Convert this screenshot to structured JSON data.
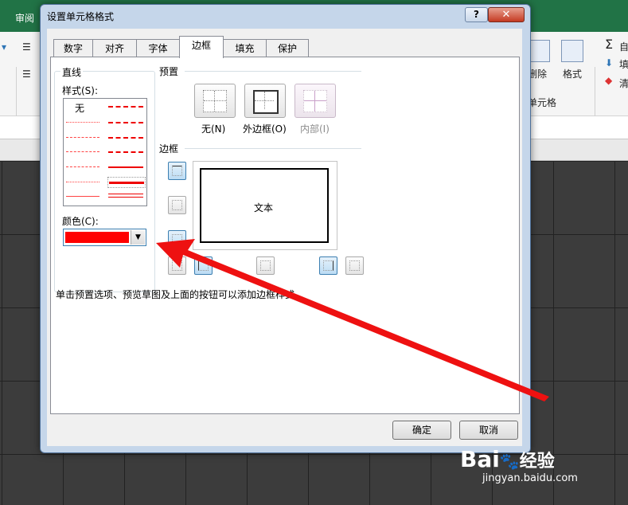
{
  "background": {
    "ribbon_tab": "审阅",
    "ribbon_items": [
      {
        "label": "删除"
      },
      {
        "label": "格式"
      },
      {
        "label": "单元格"
      },
      {
        "label": "自"
      },
      {
        "label": "填"
      },
      {
        "label": "清"
      }
    ]
  },
  "dialog": {
    "title": "设置单元格格式",
    "help_label": "?",
    "close_label": "✕",
    "tabs": [
      {
        "label": "数字"
      },
      {
        "label": "对齐"
      },
      {
        "label": "字体"
      },
      {
        "label": "边框",
        "active": true
      },
      {
        "label": "填充"
      },
      {
        "label": "保护"
      }
    ],
    "line_group": {
      "title": "直线",
      "style_label": "样式(S):",
      "none_label": "无",
      "color_label": "颜色(C):",
      "color_value": "#ff0000"
    },
    "presets": {
      "title": "预置",
      "buttons": [
        {
          "label": "无(N)"
        },
        {
          "label": "外边框(O)"
        },
        {
          "label": "内部(I)",
          "disabled": true
        }
      ]
    },
    "border": {
      "title": "边框",
      "preview_text": "文本"
    },
    "hint": "单击预置选项、预览草图及上面的按钮可以添加边框样式",
    "ok_label": "确定",
    "cancel_label": "取消"
  },
  "watermark": {
    "brand": "Bai",
    "brand_suffix": "经验",
    "url": "jingyan.baidu.com"
  },
  "colors": {
    "accent_red": "#ff0000",
    "dialog_frame": "#c5d6ea",
    "excel_green": "#217346"
  }
}
